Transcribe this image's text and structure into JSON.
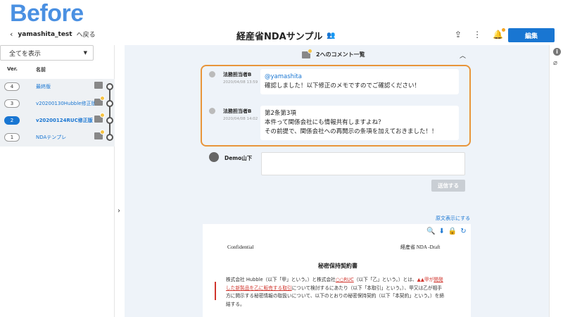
{
  "banner": {
    "text": "Before"
  },
  "header": {
    "user": "yamashita_test",
    "back_label": "へ戻る",
    "doc_title": "経産省NDAサンプル",
    "edit_label": "編集"
  },
  "sidebar": {
    "filter_value": "全てを表示",
    "col_ver": "Ver.",
    "col_name": "名前",
    "versions": [
      {
        "ver": "4",
        "name": "最終版",
        "active": false,
        "badge": false
      },
      {
        "ver": "3",
        "name": "v20200130Hubble修正版",
        "active": false,
        "badge": true
      },
      {
        "ver": "2",
        "name": "v20200124RUC修正版",
        "active": true,
        "badge": true
      },
      {
        "ver": "1",
        "name": "NDAテンプレ",
        "active": false,
        "badge": true
      }
    ]
  },
  "thread": {
    "title": "2へのコメント一覧",
    "comments": [
      {
        "author": "法務担当者B",
        "time": "2020/04/08 13:59",
        "mention": "@yamashita",
        "lines": [
          "確認しました！以下修正のメモですのでご確認ください！"
        ]
      },
      {
        "author": "法務担当者B",
        "time": "2020/04/08 14:02",
        "mention": "",
        "lines": [
          "第2条第3項",
          "本件って関係会社にも情報共有しますよね？",
          "その前提で、関係会社への再開示の条項を加えておきました！！"
        ]
      }
    ],
    "reply_author": "Demo山下",
    "send_label": "送信する"
  },
  "document": {
    "show_original": "原文表示にする",
    "confidential": "Confidential",
    "draft": "経産省 NDA -Draft",
    "heading": "秘密保持契約書",
    "body_a": "株式会社 Hubble（以下「甲」という。）と株式会社",
    "body_ruc": "○○RUC",
    "body_b": "（以下「乙」という。）とは、",
    "body_c": "▲▲甲が",
    "body_d": "開発した新製品を乙に販売する取引",
    "body_e": "について検討するにあたり（以下「本取引」という。）、甲又は乙が相手方に開示する秘密情報の取扱いについて、以下のとおりの秘密保持契約（以下「本契約」という。）を締結する。"
  },
  "colors": {
    "accent": "#1976d2",
    "highlight": "#e8953a",
    "banner": "#4a90e2",
    "edit_red": "#d0342c"
  }
}
